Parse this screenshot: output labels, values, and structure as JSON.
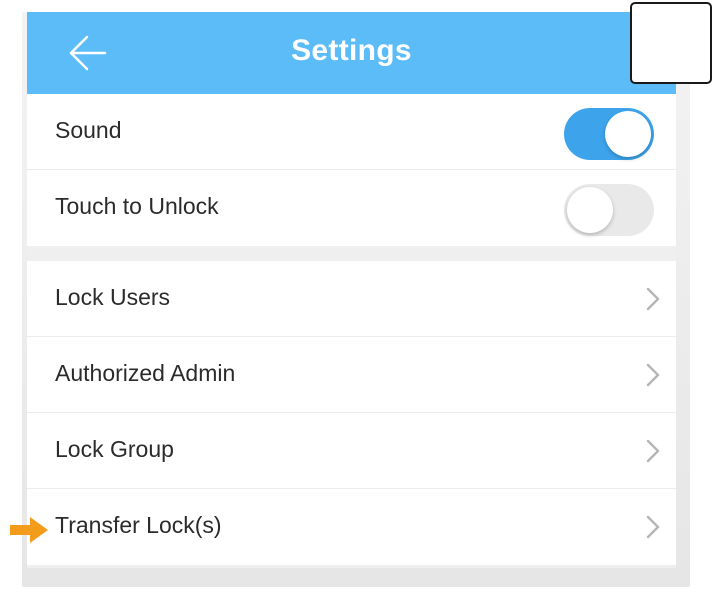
{
  "navbar": {
    "title": "Settings",
    "back_icon": "arrow-left-icon",
    "color": "#5bbcf8"
  },
  "toggles": [
    {
      "label": "Sound",
      "state": "on"
    },
    {
      "label": "Touch to Unlock",
      "state": "off"
    }
  ],
  "menu": {
    "items": [
      {
        "label": "Lock Users",
        "icon": "chevron-right-icon"
      },
      {
        "label": "Authorized Admin",
        "icon": "chevron-right-icon"
      },
      {
        "label": "Lock Group",
        "icon": "chevron-right-icon"
      },
      {
        "label": "Transfer Lock(s)",
        "icon": "chevron-right-icon"
      }
    ]
  },
  "annotation": {
    "pointer_icon": "orange-arrow-icon",
    "pointer_color": "#f39c1b"
  },
  "colors": {
    "toggle_on": "#3da4ec",
    "toggle_off": "#e9e9ea",
    "background": "#efefef"
  }
}
